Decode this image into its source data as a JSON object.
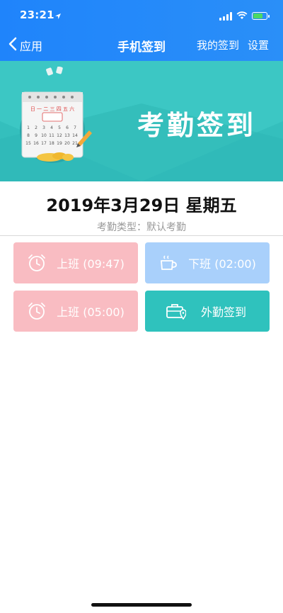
{
  "status_bar": {
    "time": "23:21"
  },
  "nav": {
    "back_label": "应用",
    "title": "手机签到",
    "my_checkin": "我的签到",
    "settings": "设置"
  },
  "banner": {
    "title": "考勤签到",
    "calendar_weekdays": "日 一 二 三 四 五 六",
    "calendar_numbers": [
      "1",
      "2",
      "3",
      "4",
      "5",
      "6",
      "7",
      "8",
      "9",
      "10",
      "11",
      "12",
      "13",
      "14",
      "15",
      "16",
      "17",
      "18",
      "19",
      "20",
      "21"
    ]
  },
  "date": {
    "full": "2019年3月29日 星期五",
    "type_label": "考勤类型：默认考勤"
  },
  "buttons": {
    "work_on_1": "上班 (09:47)",
    "work_off": "下班 (02:00)",
    "work_on_2": "上班 (05:00)",
    "field_checkin": "外勤签到"
  },
  "colors": {
    "nav_bg": "#1f84fb",
    "banner_bg": "#34bfbd",
    "pink_button": "#f9bcc2",
    "blue_button": "#a9d0fb",
    "teal_button": "#2fc2bd"
  }
}
